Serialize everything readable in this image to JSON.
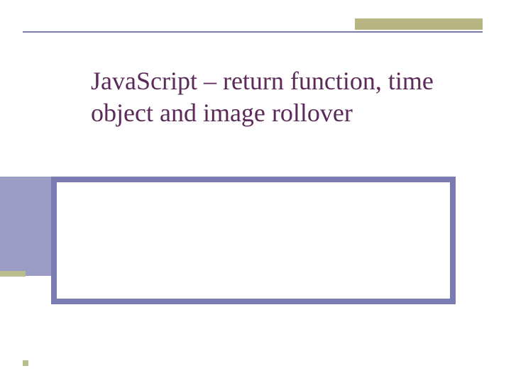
{
  "slide": {
    "title": "JavaScript – return function, time object and image rollover"
  },
  "colors": {
    "accent_olive": "#b7b581",
    "accent_purple_line": "#7a7bb0",
    "title_text": "#5b2a59",
    "sidebar_fill": "#9c9dc4"
  }
}
